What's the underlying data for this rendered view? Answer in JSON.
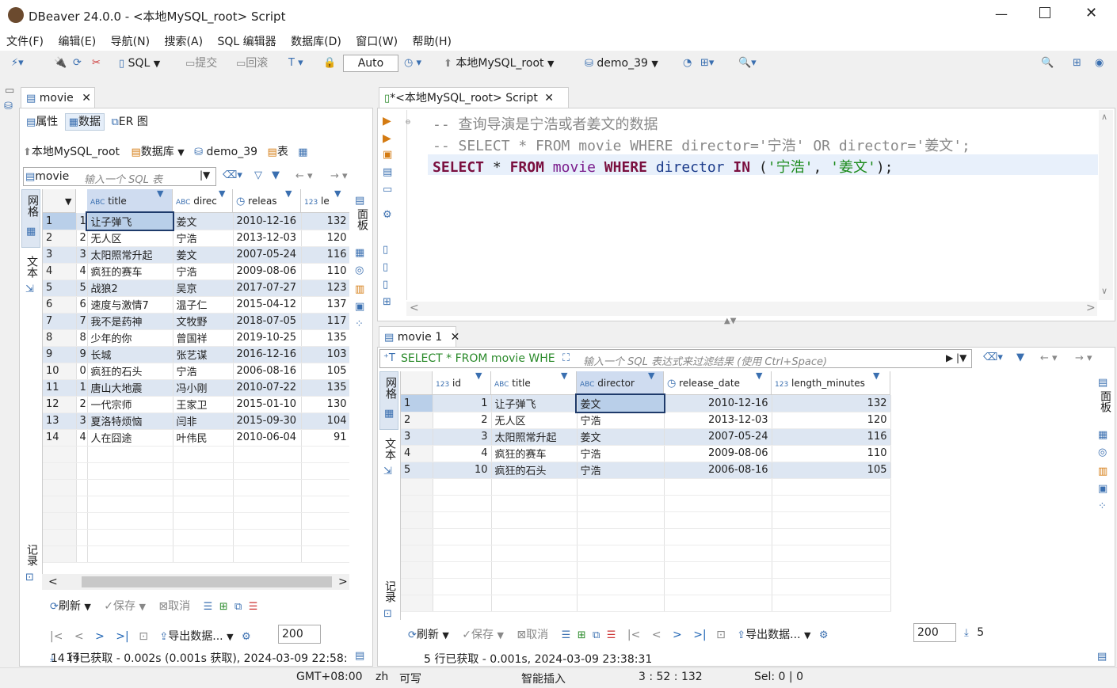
{
  "window": {
    "title": "DBeaver 24.0.0 - <本地MySQL_root> Script"
  },
  "menu": [
    "文件(F)",
    "编辑(E)",
    "导航(N)",
    "搜索(A)",
    "SQL 编辑器",
    "数据库(D)",
    "窗口(W)",
    "帮助(H)"
  ],
  "toolbar": {
    "sql": "SQL",
    "commit": "提交",
    "rollback": "回滚",
    "auto": "Auto",
    "connection": "本地MySQL_root",
    "database": "demo_39"
  },
  "left": {
    "tab": "movie",
    "subtabs": [
      "属性",
      "数据",
      "ER 图"
    ],
    "breadcrumb": {
      "conn": "本地MySQL_root",
      "db_label": "数据库",
      "db": "demo_39",
      "tbl_label": "表"
    },
    "filter_table": "movie",
    "filter_placeholder": "输入一个 SQL 表",
    "columns": [
      "title",
      "direc",
      "releas",
      "le"
    ],
    "rows": [
      [
        "1",
        "1",
        "让子弹飞",
        "姜文",
        "2010-12-16",
        "132"
      ],
      [
        "2",
        "2",
        "无人区",
        "宁浩",
        "2013-12-03",
        "120"
      ],
      [
        "3",
        "3",
        "太阳照常升起",
        "姜文",
        "2007-05-24",
        "116"
      ],
      [
        "4",
        "4",
        "疯狂的赛车",
        "宁浩",
        "2009-08-06",
        "110"
      ],
      [
        "5",
        "5",
        "战狼2",
        "吴京",
        "2017-07-27",
        "123"
      ],
      [
        "6",
        "6",
        "速度与激情7",
        "温子仁",
        "2015-04-12",
        "137"
      ],
      [
        "7",
        "7",
        "我不是药神",
        "文牧野",
        "2018-07-05",
        "117"
      ],
      [
        "8",
        "8",
        "少年的你",
        "曾国祥",
        "2019-10-25",
        "135"
      ],
      [
        "9",
        "9",
        "长城",
        "张艺谋",
        "2016-12-16",
        "103"
      ],
      [
        "10",
        "0",
        "疯狂的石头",
        "宁浩",
        "2006-08-16",
        "105"
      ],
      [
        "11",
        "1",
        "唐山大地震",
        "冯小刚",
        "2010-07-22",
        "135"
      ],
      [
        "12",
        "2",
        "一代宗师",
        "王家卫",
        "2015-01-10",
        "130"
      ],
      [
        "13",
        "3",
        "夏洛特烦恼",
        "闫非",
        "2015-09-30",
        "104"
      ],
      [
        "14",
        "4",
        "人在囧途",
        "叶伟民",
        "2010-06-04",
        "91"
      ]
    ],
    "side_grid": "网格",
    "side_text": "文本",
    "side_record": "记录",
    "side_panel": "面板",
    "refresh": "刷新",
    "save": "保存",
    "cancel": "取消",
    "export": "导出数据...",
    "fetch_size": "200",
    "count": "14",
    "status": "14 行已获取 - 0.002s (0.001s 获取), 2024-03-09 22:58:"
  },
  "editor": {
    "tab": "*<本地MySQL_root> Script",
    "line1": "-- 查询导演是宁浩或者姜文的数据",
    "line2": "-- SELECT * FROM movie WHERE director='宁浩' OR director='姜文';",
    "sql": {
      "select": "SELECT",
      "star": "*",
      "from": "FROM",
      "table": "movie",
      "where": "WHERE",
      "column": "director",
      "in": "IN",
      "lp": "(",
      "v1": "'宁浩'",
      "comma": ",",
      "v2": "'姜文'",
      "rp": ");"
    }
  },
  "result": {
    "tab": "movie 1",
    "query": "SELECT * FROM movie WHE",
    "filter_placeholder": "输入一个 SQL 表达式来过滤结果 (使用 Ctrl+Space)",
    "columns": [
      "id",
      "title",
      "director",
      "release_date",
      "length_minutes"
    ],
    "rows": [
      [
        "1",
        "1",
        "让子弹飞",
        "姜文",
        "2010-12-16",
        "132"
      ],
      [
        "2",
        "2",
        "无人区",
        "宁浩",
        "2013-12-03",
        "120"
      ],
      [
        "3",
        "3",
        "太阳照常升起",
        "姜文",
        "2007-05-24",
        "116"
      ],
      [
        "4",
        "4",
        "疯狂的赛车",
        "宁浩",
        "2009-08-06",
        "110"
      ],
      [
        "5",
        "10",
        "疯狂的石头",
        "宁浩",
        "2006-08-16",
        "105"
      ]
    ],
    "refresh": "刷新",
    "save": "保存",
    "cancel": "取消",
    "export": "导出数据...",
    "fetch_size": "200",
    "count": "5",
    "status": "5 行已获取 - 0.001s, 2024-03-09 23:38:31"
  },
  "statusbar": {
    "tz": "GMT+08:00",
    "lang": "zh",
    "mode": "可写",
    "insert": "智能插入",
    "pos": "3 : 52 : 132",
    "sel": "Sel: 0 | 0"
  }
}
